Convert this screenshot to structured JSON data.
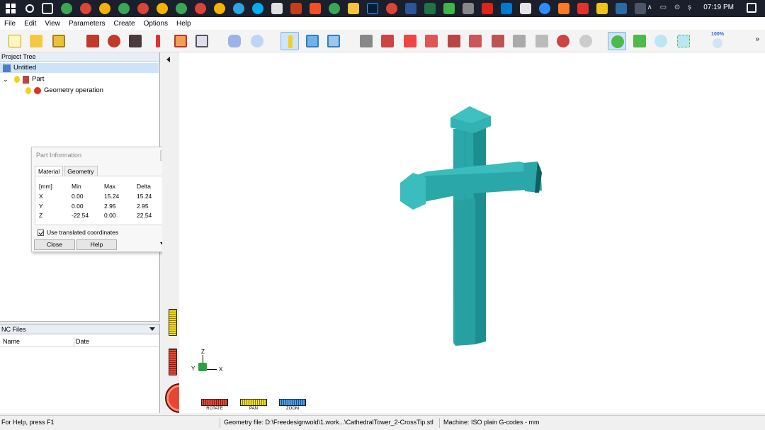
{
  "taskbar": {
    "clock": "07:19 PM",
    "tray": "∧ ▭ ⊙ ș",
    "apps": [
      "search",
      "task-view",
      "chrome",
      "chrome",
      "chrome",
      "chrome",
      "chrome",
      "chrome",
      "chrome",
      "chrome",
      "chrome",
      "chrome",
      "chrome",
      "telegram",
      "skype",
      "windows-store",
      "mail",
      "store",
      "chrome",
      "file-explorer",
      "photoshop",
      "chrome",
      "word",
      "excel",
      "camtasia",
      "gallery",
      "acrobat",
      "vscode",
      "mail",
      "zoom",
      "xampp",
      "sketchup",
      "settings",
      "sheets",
      "network"
    ]
  },
  "menu": [
    "File",
    "Edit",
    "View",
    "Parameters",
    "Create",
    "Options",
    "Help"
  ],
  "toolbar": {
    "zoom_label": "100%",
    "more": "»"
  },
  "project_tree": {
    "title": "Project Tree",
    "root": "Untitled",
    "part": "Part",
    "child": "Geometry operation"
  },
  "part_info": {
    "title": "Part Information",
    "tabs": [
      "Material",
      "Geometry"
    ],
    "header": [
      "[mm]",
      "Min",
      "Max",
      "Delta"
    ],
    "rows": [
      [
        "X",
        "0.00",
        "15.24",
        "15.24"
      ],
      [
        "Y",
        "0.00",
        "2.95",
        "2.95"
      ],
      [
        "Z",
        "-22.54",
        "0.00",
        "22.54"
      ]
    ],
    "checkbox_label": "Use translated coordinates",
    "close_label": "Close",
    "help_label": "Help"
  },
  "nc_files": {
    "title": "NC Files",
    "col_name": "Name",
    "col_date": "Date"
  },
  "viewport": {
    "axis_z": "Z",
    "axis_y": "Y",
    "axis_x": "X",
    "rotate_label": "ROTATE",
    "pan_label": "PAN",
    "zoom_label": "ZOOM",
    "model_color": "#2aa7a8"
  },
  "status": {
    "help": "For Help, press F1",
    "geometry": "Geometry file: D:\\Freedesignwold\\1.work...\\CathedralTower_2-CrossTip.stl",
    "machine": "Machine: ISO plain G-codes - mm"
  }
}
